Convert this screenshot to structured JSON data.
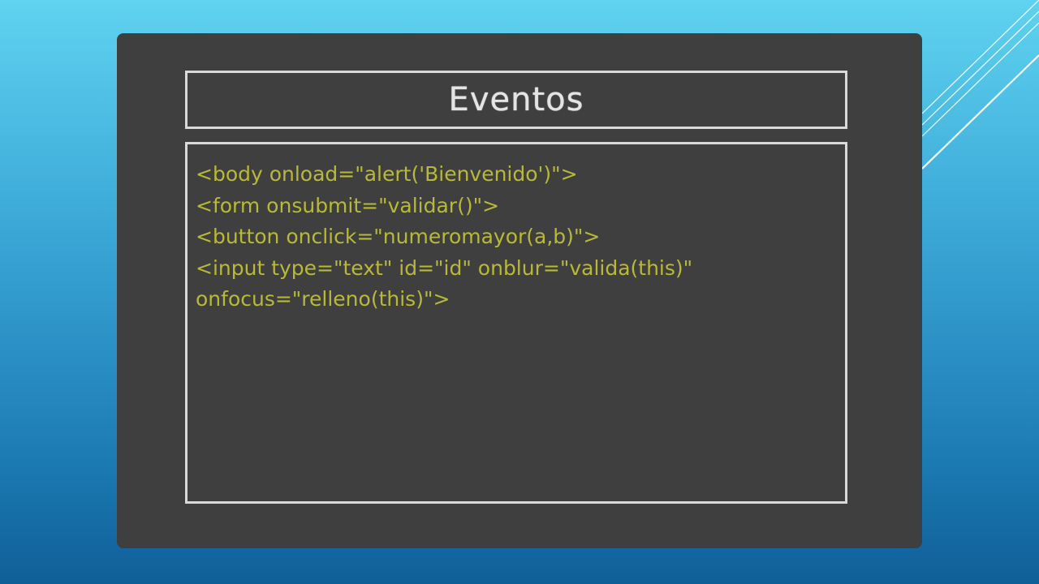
{
  "slide": {
    "title": "Eventos",
    "code_lines": [
      "<body onload=\"alert('Bienvenido')\">",
      "<form onsubmit=\"validar()\">",
      "<button onclick=\"numeromayor(a,b)\">",
      "<input type=\"text\" id=\"id\" onblur=\"valida(this)\"",
      "onfocus=\"relleno(this)\">"
    ]
  },
  "colors": {
    "background_top": "#5fd3f0",
    "background_bottom": "#0f5f98",
    "board": "#3f3f3f",
    "border": "#d9d9d9",
    "title_text": "#e4e4e4",
    "code_text": "#b9b937"
  }
}
